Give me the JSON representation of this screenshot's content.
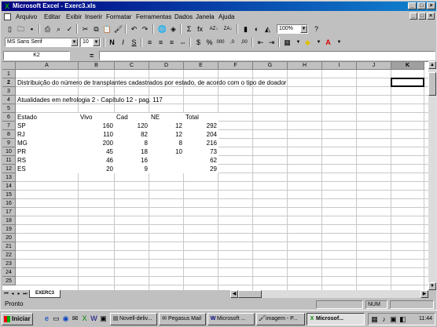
{
  "window": {
    "title": "Microsoft Excel - Exerc3.xls",
    "controls": {
      "minimize": "_",
      "maximize": "□",
      "close": "×"
    }
  },
  "menu": {
    "items": [
      "Arquivo",
      "Editar",
      "Exibir",
      "Inserir",
      "Formatar",
      "Ferramentas",
      "Dados",
      "Janela",
      "Ajuda"
    ]
  },
  "toolbar": {
    "zoom": "100%",
    "font_name": "MS Sans Serif",
    "font_size": "10",
    "bold": "N",
    "italic": "I",
    "underline": "S",
    "sum": "Σ",
    "fx": "fx",
    "az": "AZ↓",
    "za": "ZA↓",
    "currency": "$",
    "percent": "%",
    "thousands": "000",
    "dec_inc": ",0",
    "dec_dec": ",00",
    "font_color_letter": "A"
  },
  "formula_bar": {
    "cell_ref": "K2",
    "equals": "=",
    "content": ""
  },
  "sheet": {
    "columns": [
      "A",
      "B",
      "C",
      "D",
      "E",
      "F",
      "G",
      "H",
      "I",
      "J",
      "K"
    ],
    "active_column": "K",
    "rows": [
      "1",
      "2",
      "3",
      "4",
      "5",
      "6",
      "7",
      "8",
      "9",
      "10",
      "11",
      "12",
      "13",
      "14",
      "15",
      "16",
      "17",
      "18",
      "19",
      "20",
      "21",
      "22",
      "23",
      "24",
      "25"
    ],
    "active_row": "2",
    "title_text": "Distribuição do número de transplantes cadastrados por estado, de acordo com o tipo de doador",
    "source_text": "Atualidades em nefrologia 2 - Capítulo 12 - pag. 117",
    "headers": [
      "Estado",
      "Vivo",
      "Cad",
      "NE",
      "Total"
    ],
    "data_rows": [
      [
        "SP",
        "160",
        "120",
        "12",
        "292"
      ],
      [
        "RJ",
        "110",
        "82",
        "12",
        "204"
      ],
      [
        "MG",
        "200",
        "8",
        "8",
        "216"
      ],
      [
        "PR",
        "45",
        "18",
        "10",
        "73"
      ],
      [
        "RS",
        "46",
        "16",
        "",
        "62"
      ],
      [
        "ES",
        "20",
        "9",
        "",
        "29"
      ]
    ],
    "tab_name": "EXERC3"
  },
  "status": {
    "text": "Pronto",
    "num": "NUM"
  },
  "taskbar": {
    "start": "Iniciar",
    "tasks": [
      {
        "label": "Novell-deliv...",
        "active": false
      },
      {
        "label": "Pegasus Mail",
        "active": false
      },
      {
        "label": "Microsoft ...",
        "active": false
      },
      {
        "label": "imagem - P...",
        "active": false
      },
      {
        "label": "Microsof...",
        "active": true
      }
    ],
    "clock": "11:44"
  }
}
